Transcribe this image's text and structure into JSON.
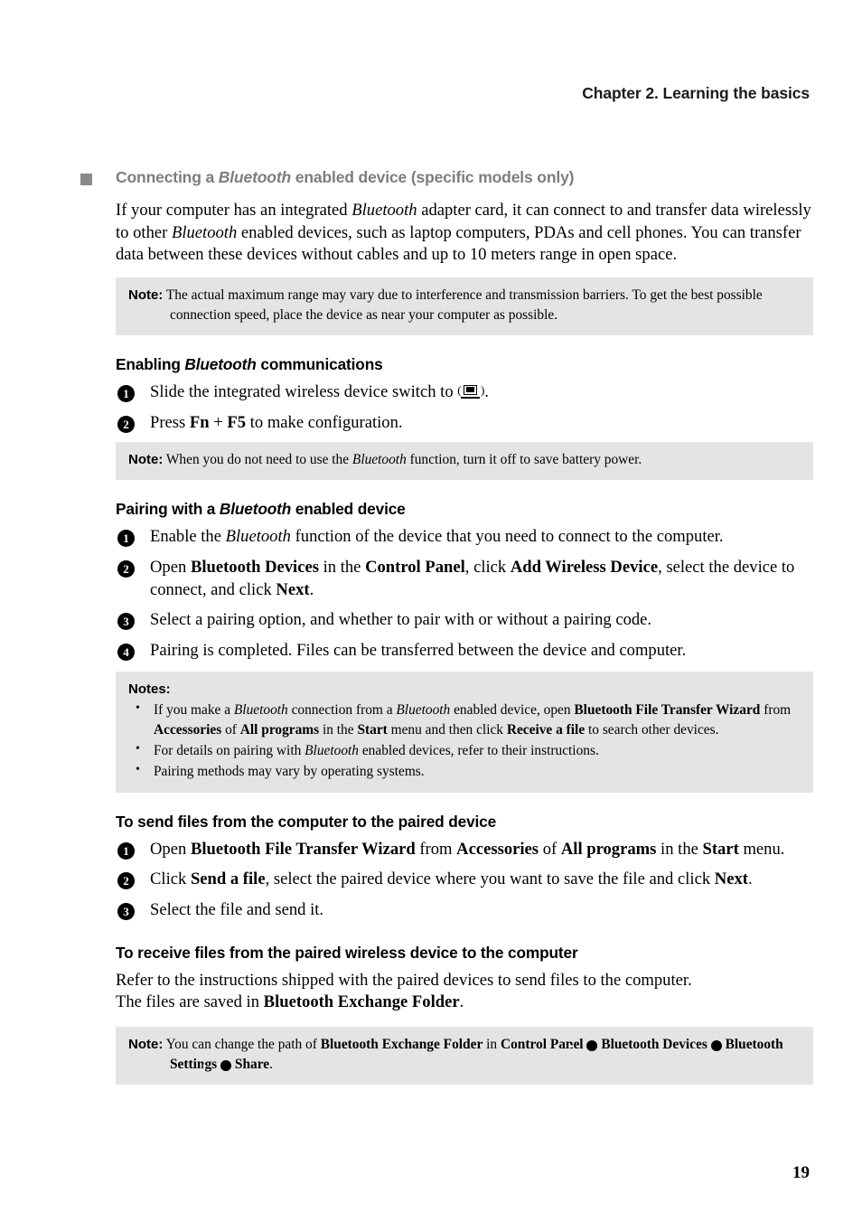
{
  "header": {
    "chapter": "Chapter 2. Learning the basics"
  },
  "section": {
    "title_part1": "Connecting a ",
    "title_em": "Bluetooth",
    "title_part2": " enabled device (specific models only)",
    "bullet_color": "#8a8a8a",
    "heading_color": "#7d7d7d"
  },
  "intro": {
    "p1a": "If your computer has an integrated ",
    "p1em": "Bluetooth",
    "p1b": " adapter card, it can connect to and transfer data wirelessly to other ",
    "p1em2": "Bluetooth",
    "p1c": " enabled devices, such as laptop computers, PDAs and cell phones. You can transfer data between these devices without cables and up to 10 meters range in open space."
  },
  "note1": {
    "label": "Note:",
    "text": "The actual maximum range may vary due to interference and transmission barriers. To get the best possible connection speed, place the device as near your computer as possible."
  },
  "enabling": {
    "head_a": "Enabling ",
    "head_em": "Bluetooth",
    "head_b": " communications",
    "step1_a": "Slide the integrated wireless device switch to ",
    "step1_b": ".",
    "step1_icon": "wireless-device-switch-icon",
    "step2_a": "Press ",
    "step2_fn": "Fn",
    "step2_plus": " + ",
    "step2_f5": "F5",
    "step2_b": " to make configuration.",
    "num1": "1",
    "num2": "2"
  },
  "note2": {
    "label": "Note:",
    "text_a": "When you do not need to use the ",
    "text_em": "Bluetooth",
    "text_b": " function, turn it off to save battery power."
  },
  "pairing": {
    "head_a": "Pairing with a ",
    "head_em": "Bluetooth",
    "head_b": " enabled device",
    "num1": "1",
    "num2": "2",
    "num3": "3",
    "num4": "4",
    "step1_a": "Enable the ",
    "step1_em": "Bluetooth",
    "step1_b": " function of the device that you need to connect to the computer.",
    "step2_a": "Open ",
    "step2_b1": "Bluetooth Devices",
    "step2_b": " in the ",
    "step2_b2": "Control Panel",
    "step2_c": ", click ",
    "step2_b3": "Add Wireless Device",
    "step2_d": ", select the device to connect, and click ",
    "step2_b4": "Next",
    "step2_e": ".",
    "step3": "Select a pairing option, and whether to pair with or without a pairing code.",
    "step4": "Pairing is completed. Files can be transferred between the device and computer."
  },
  "notes_box": {
    "heading": "Notes:",
    "bullet_glyph": "•",
    "items": [
      {
        "a": "If you make a ",
        "em1": "Bluetooth",
        "b": " connection from a ",
        "em2": "Bluetooth",
        "c": " enabled device, open ",
        "bold1": "Bluetooth File Transfer Wizard",
        "d": " from ",
        "bold2": "Accessories",
        "e": " of ",
        "bold3": "All programs",
        "f": " in the ",
        "bold4": "Start",
        "g": " menu and then click ",
        "bold5": "Receive a file",
        "h": " to search other devices."
      },
      {
        "a": "For details on pairing with ",
        "em1": "Bluetooth",
        "b": " enabled devices, refer to their instructions."
      },
      {
        "a": "Pairing methods may vary by operating systems."
      }
    ]
  },
  "send_files": {
    "head": "To send files from the computer to the paired device",
    "num1": "1",
    "num2": "2",
    "num3": "3",
    "step1_a": "Open ",
    "step1_b1": "Bluetooth File Transfer Wizard",
    "step1_b": " from ",
    "step1_b2": "Accessories",
    "step1_c": " of ",
    "step1_b3": "All programs",
    "step1_d": " in the ",
    "step1_b4": "Start",
    "step1_e": " menu.",
    "step2_a": "Click ",
    "step2_b1": "Send a file",
    "step2_b": ", select the paired device where you want to save the file and click ",
    "step2_b2": "Next",
    "step2_c": ".",
    "step3": "Select the file and send it."
  },
  "receive_files": {
    "head": "To receive files from the paired wireless device to the computer",
    "line1": "Refer to the instructions shipped with the paired devices to send files to the computer.",
    "line2_a": "The files are saved in ",
    "line2_b": "Bluetooth Exchange Folder",
    "line2_c": "."
  },
  "note3": {
    "label": "Note:",
    "a": "You can change the path of ",
    "b1": "Bluetooth Exchange Folder",
    "b": " in ",
    "b2": "Control Panel",
    "sep": "▸",
    "c": " ",
    "b3": "Bluetooth Devices",
    "d": " ",
    "b4": "Bluetooth Settings",
    "e": " ",
    "b5": "Share",
    "f": "."
  },
  "footer": {
    "page_number": "19"
  }
}
